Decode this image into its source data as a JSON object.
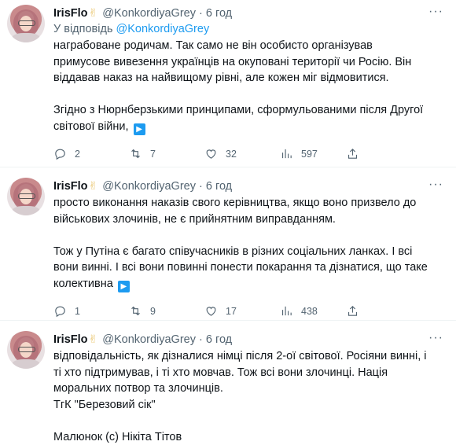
{
  "tweets": [
    {
      "name": "IrisFlo",
      "emoji": "✌",
      "handle": "@KonkordiyaGrey",
      "dot": "·",
      "time": "6 год",
      "reply_to_prefix": "У відповідь",
      "reply_to_handle": "@KonkordiyaGrey",
      "lines": [
        "награбоване родичам. Так само не він особисто організував",
        "примусове вивезення українців на окуповані території чи Росію. Він",
        "віддавав наказ на найвищому рівні, але кожен міг відмовитися.",
        "",
        "Згідно з Нюрнберзькими принципами, сформульованими після Другої",
        "світової війни,"
      ],
      "show_more": "▶",
      "replies": "2",
      "retweets": "7",
      "likes": "32",
      "views": "597"
    },
    {
      "name": "IrisFlo",
      "emoji": "✌",
      "handle": "@KonkordiyaGrey",
      "dot": "·",
      "time": "6 год",
      "lines": [
        "просто виконання наказів свого керівництва, якщо воно призвело до",
        "військових злочинів, не є прийнятним виправданням.",
        "",
        "Тож у Путіна є багато співучасників в різних соціальних ланках. І всі",
        "вони винні. І всі вони повинні понести покарання та дізнатися, що таке",
        "колективна"
      ],
      "show_more": "▶",
      "replies": "1",
      "retweets": "9",
      "likes": "17",
      "views": "438"
    },
    {
      "name": "IrisFlo",
      "emoji": "✌",
      "handle": "@KonkordiyaGrey",
      "dot": "·",
      "time": "6 год",
      "lines": [
        "відповідальність, як дізналися німці після 2-ої світової. Росіяни винні, і",
        "ті хто підтримував, і ті хто мовчав. Тож всі вони злочинці. Нація",
        "моральних потвор та злочинців.",
        "ТгК \"Березовий сік\"",
        "",
        "Малюнок (с) Нікіта Тітов"
      ]
    }
  ],
  "icons": {
    "reply": "reply-icon",
    "retweet": "retweet-icon",
    "like": "like-icon",
    "views": "views-icon",
    "share": "share-icon",
    "more": "more-icon"
  }
}
